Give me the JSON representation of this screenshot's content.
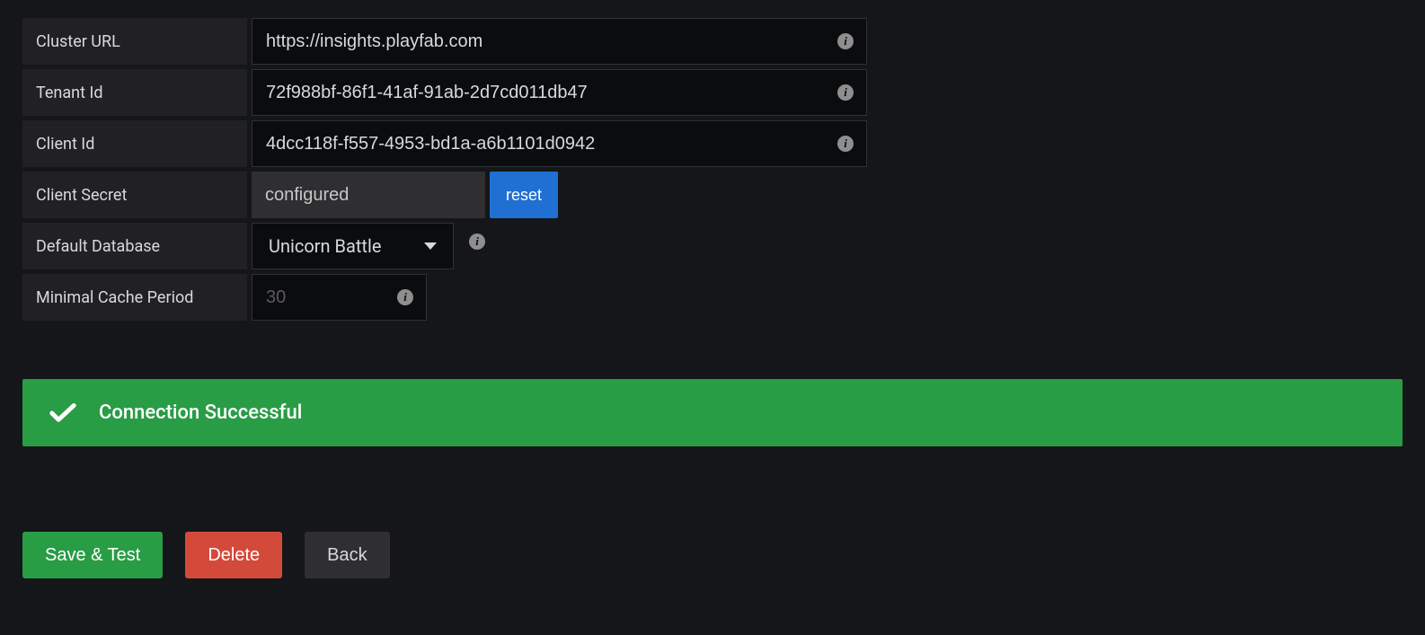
{
  "fields": {
    "cluster_url": {
      "label": "Cluster URL",
      "value": "https://insights.playfab.com"
    },
    "tenant_id": {
      "label": "Tenant Id",
      "value": "72f988bf-86f1-41af-91ab-2d7cd011db47"
    },
    "client_id": {
      "label": "Client Id",
      "value": "4dcc118f-f557-4953-bd1a-a6b1101d0942"
    },
    "client_secret": {
      "label": "Client Secret",
      "value": "configured",
      "reset_label": "reset"
    },
    "default_database": {
      "label": "Default Database",
      "value": "Unicorn Battle"
    },
    "minimal_cache_period": {
      "label": "Minimal Cache Period",
      "value": "30"
    }
  },
  "alert": {
    "text": "Connection Successful"
  },
  "buttons": {
    "save_test": "Save & Test",
    "delete": "Delete",
    "back": "Back"
  }
}
